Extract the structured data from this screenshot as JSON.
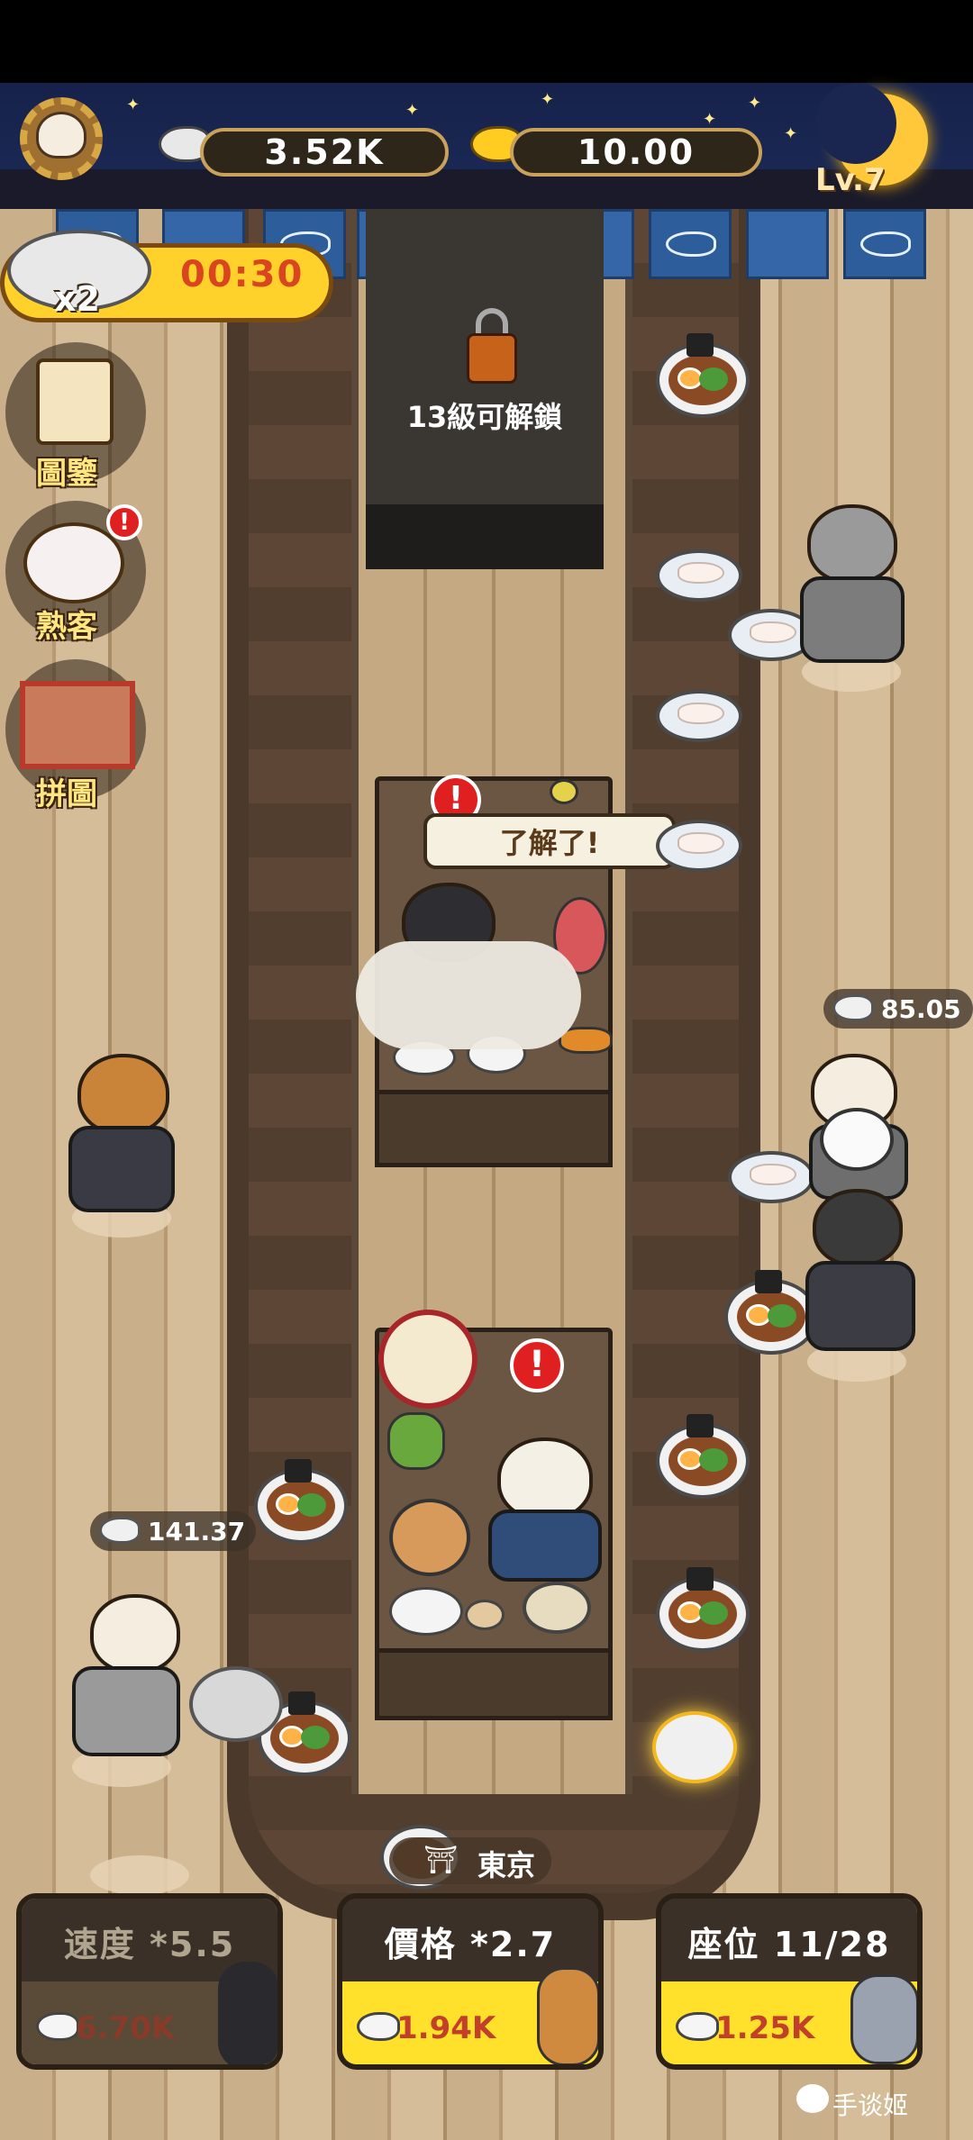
{
  "header": {
    "silver_fish": "3.52K",
    "gold_fish": "10.00",
    "level": "Lv.7"
  },
  "boost": {
    "multiplier": "x2",
    "timer": "00:30"
  },
  "menu": {
    "items": [
      {
        "label": "圖鑒",
        "icon": "book-icon"
      },
      {
        "label": "熟客",
        "icon": "paw-icon"
      },
      {
        "label": "拼圖",
        "icon": "puzzle-icon"
      }
    ]
  },
  "locked_area": {
    "text": "13級可解鎖"
  },
  "chef_bubble": "了解了!",
  "money_tags": {
    "right": "85.05",
    "left": "141.37"
  },
  "city": "東京",
  "panels": [
    {
      "title": "速度",
      "multiplier": "*5.5",
      "cost": "6.70K",
      "enabled": false
    },
    {
      "title": "價格",
      "multiplier": "*2.7",
      "cost": "1.94K",
      "enabled": true
    },
    {
      "title": "座位",
      "multiplier": "11/28",
      "cost": "1.25K",
      "enabled": true
    }
  ],
  "watermark": "手谈姬",
  "colors": {
    "accent_yellow": "#ffd12a",
    "cost_red": "#c2402a",
    "alert_red": "#e02020",
    "header_navy": "#1c2a58"
  }
}
